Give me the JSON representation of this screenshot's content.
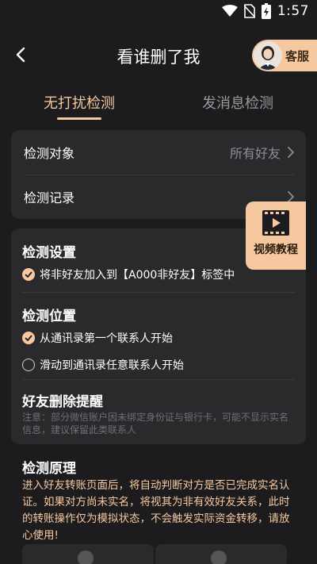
{
  "status_bar": {
    "time": "1:57"
  },
  "header": {
    "title": "看谁删了我",
    "service_label": "客服"
  },
  "tabs": [
    {
      "label": "无打扰检测",
      "active": true
    },
    {
      "label": "发消息检测",
      "active": false
    }
  ],
  "target_card": {
    "target_label": "检测对象",
    "target_value": "所有好友",
    "record_label": "检测记录"
  },
  "video_tutorial": {
    "label": "视频教程"
  },
  "settings": {
    "settings_title": "检测设置",
    "settings_option": "将非好友加入到【A000非好友】标签中",
    "position_title": "检测位置",
    "position_option_1": "从通讯录第一个联系人开始",
    "position_option_2": "滑动到通讯录任意联系人开始",
    "reminder_title": "好友删除提醒",
    "reminder_note": "注意：部分微信账户因未绑定身份证与银行卡，可能不显示实名信息，建议保留此类联系人"
  },
  "principle": {
    "title": "检测原理",
    "text": "进入好友转账页面后，将自动判断对方是否已完成实名认证。如果对方尚未实名，将视其为非有效好友关系，此时的转账操作仅为模拟状态，不会触发实际资金转移，请放心使用!"
  },
  "colors": {
    "accent": "#f6c89f",
    "background": "#1c1c1e",
    "card": "#2a2a2d"
  }
}
